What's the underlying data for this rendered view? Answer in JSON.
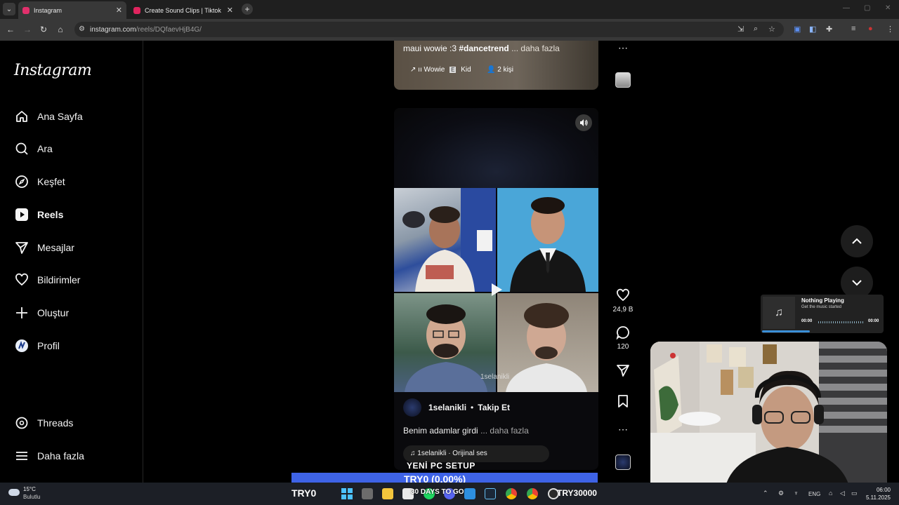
{
  "browser": {
    "tabs": [
      {
        "title": "Instagram",
        "favicon_color": "#e1306c"
      },
      {
        "title": "Create Sound Clips | Tiktok You",
        "favicon_color": "#e0245e"
      }
    ],
    "url_host": "instagram.com",
    "url_path": "/reels/DQfaevHjB4G/"
  },
  "sidebar": {
    "logo": "Instagram",
    "items": [
      {
        "label": "Ana Sayfa",
        "icon": "home-icon"
      },
      {
        "label": "Ara",
        "icon": "search-icon"
      },
      {
        "label": "Keşfet",
        "icon": "compass-icon"
      },
      {
        "label": "Reels",
        "icon": "reels-icon"
      },
      {
        "label": "Mesajlar",
        "icon": "messages-icon"
      },
      {
        "label": "Bildirimler",
        "icon": "heart-icon"
      },
      {
        "label": "Oluştur",
        "icon": "plus-icon"
      },
      {
        "label": "Profil",
        "icon": "avatar"
      },
      {
        "label": "Threads",
        "icon": "threads-icon"
      },
      {
        "label": "Daha fazla",
        "icon": "menu-icon"
      }
    ]
  },
  "previous_reel": {
    "caption_text": "maui wowie :3 ",
    "caption_tag": "#dancetrend",
    "caption_more": "... daha fazla",
    "audio_label": "ıı Wowie",
    "explicit_badge": "E",
    "audio_artist": "Kid",
    "people_label": "2 kişi"
  },
  "reel": {
    "watermark": "1selanikli",
    "author": "1selanikli",
    "separator": "•",
    "follow_label": "Takip Et",
    "caption": "Benim adamlar girdi",
    "caption_more": "... daha fazla",
    "audio": "1selanikli · Orijinal ses"
  },
  "rail": {
    "likes": "24,9 B",
    "comments": "120"
  },
  "music_widget": {
    "title": "Nothing Playing",
    "subtitle": "Get the music started",
    "time_start": "00:00",
    "time_end": "00:00"
  },
  "stream_overlay": {
    "setup_text": "YENİ PC SETUP",
    "ticker_text": "TRY0 (0.00%)"
  },
  "taskbar": {
    "temperature": "15°C",
    "condition": "Bulutlu",
    "left_ticker": "TRY0",
    "days_text": "30 DAYS TO GO",
    "right_ticker": "TRY30000",
    "lang": "ENG",
    "time": "06:00",
    "date": "5.11.2025"
  }
}
